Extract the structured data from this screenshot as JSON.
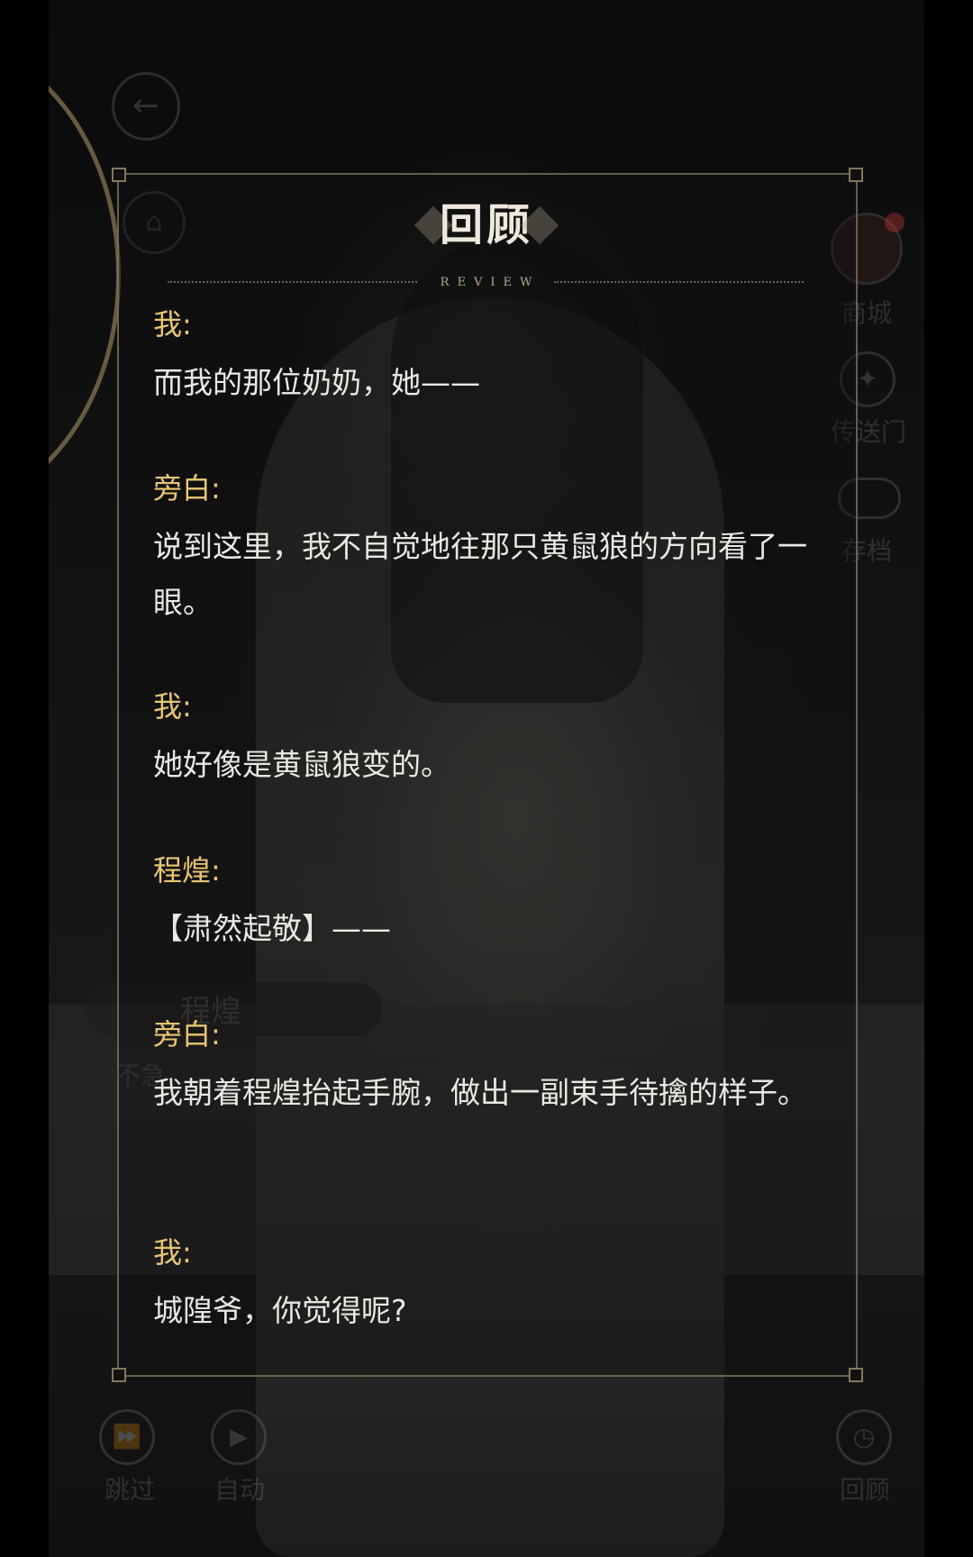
{
  "background": {
    "name_label": "程煌",
    "dialogue_snippet": "不急",
    "side_menu": [
      "商城",
      "传送门",
      "存档"
    ],
    "bottom_controls": [
      "跳过",
      "自动",
      "回顾"
    ]
  },
  "review": {
    "title": "回顾",
    "subtitle": "REVIEW",
    "entries": [
      {
        "speaker": "我:",
        "text": "而我的那位奶奶，她——"
      },
      {
        "speaker": "旁白:",
        "text": "说到这里，我不自觉地往那只黄鼠狼的方向看了一眼。"
      },
      {
        "speaker": "我:",
        "text": "她好像是黄鼠狼变的。"
      },
      {
        "speaker": "程煌:",
        "text": "【肃然起敬】——"
      },
      {
        "speaker": "旁白:",
        "text": "我朝着程煌抬起手腕，做出一副束手待擒的样子。"
      },
      {
        "speaker": "我:",
        "text": "城隍爷，你觉得呢?"
      }
    ]
  },
  "colors": {
    "speaker": "#e9c672",
    "text": "#ebe8e3",
    "frame": "#877a62"
  },
  "icons": {
    "back": "arrow-left-icon",
    "home": "home-icon",
    "shop": "avatar-icon",
    "portal": "compass-icon",
    "save": "cloud-download-icon",
    "skip": "fast-forward-icon",
    "auto": "play-icon",
    "history": "clock-icon"
  }
}
